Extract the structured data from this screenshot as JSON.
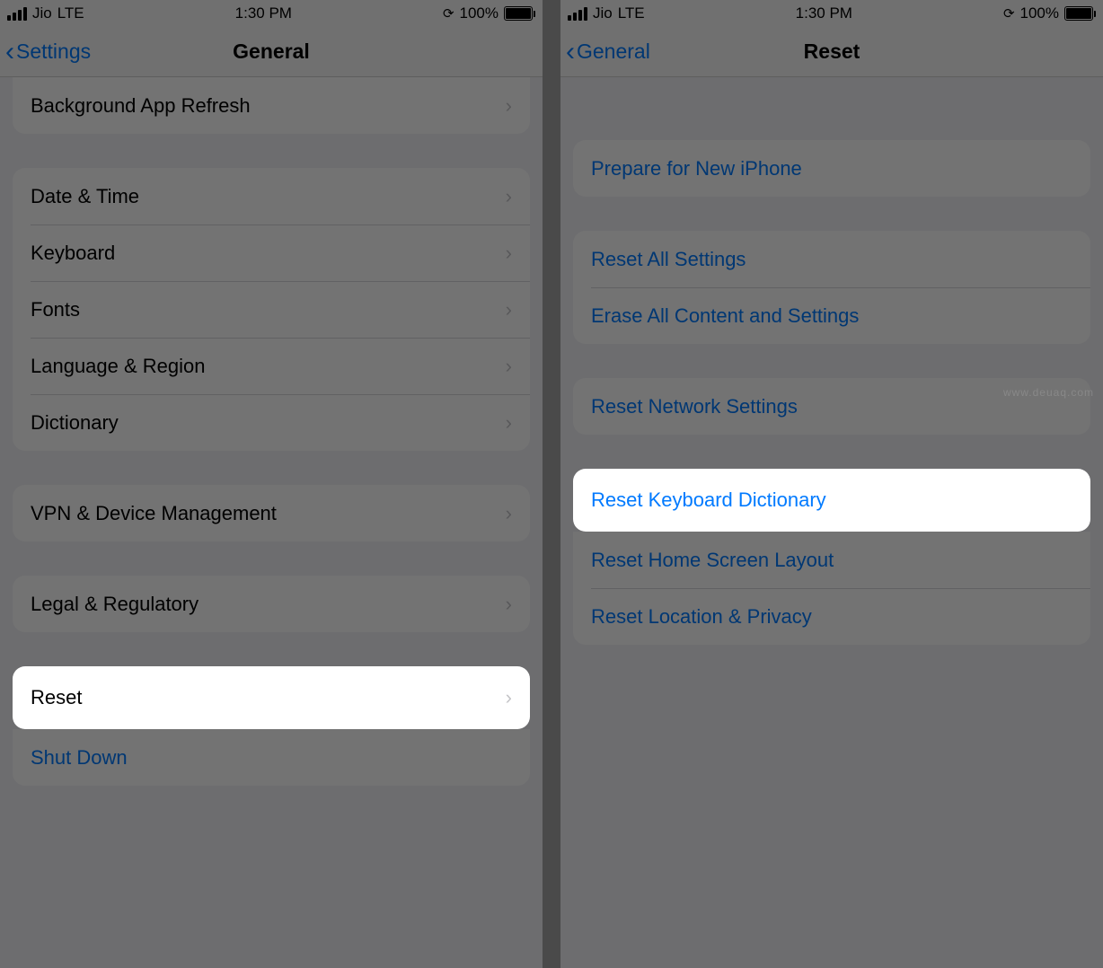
{
  "statusBar": {
    "carrier": "Jio",
    "network": "LTE",
    "time": "1:30 PM",
    "batteryPct": "100%"
  },
  "left": {
    "back": "Settings",
    "title": "General",
    "group0": {
      "bgRefresh": "Background App Refresh"
    },
    "group1": {
      "dateTime": "Date & Time",
      "keyboard": "Keyboard",
      "fonts": "Fonts",
      "langRegion": "Language & Region",
      "dictionary": "Dictionary"
    },
    "group2": {
      "vpn": "VPN & Device Management"
    },
    "group3": {
      "legal": "Legal & Regulatory"
    },
    "group4": {
      "reset": "Reset",
      "shutdown": "Shut Down"
    }
  },
  "right": {
    "back": "General",
    "title": "Reset",
    "group0": {
      "prepare": "Prepare for New iPhone"
    },
    "group1": {
      "resetAll": "Reset All Settings",
      "eraseAll": "Erase All Content and Settings"
    },
    "group2": {
      "network": "Reset Network Settings"
    },
    "group3": {
      "kbDict": "Reset Keyboard Dictionary",
      "homeLayout": "Reset Home Screen Layout",
      "locPriv": "Reset Location & Privacy"
    }
  },
  "watermark": "www.deuaq.com"
}
